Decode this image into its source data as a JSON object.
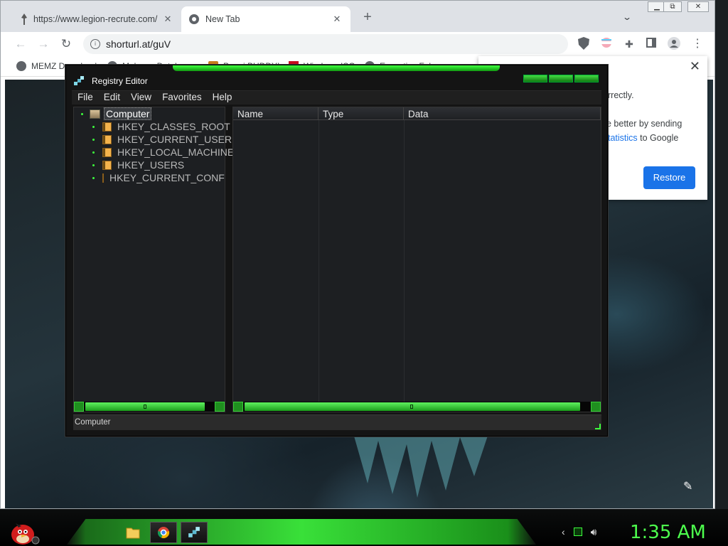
{
  "browser": {
    "tabs": [
      {
        "title": "https://www.legion-recrute.com/",
        "close": "✕"
      },
      {
        "title": "New Tab",
        "close": "✕"
      }
    ],
    "new_tab": "+",
    "url": "shorturl.at/guV",
    "bookmarks": [
      "MEMZ Download",
      "Malware Databases",
      "Penni BUDDY!",
      "Windows ISOs",
      "Executive Ful..."
    ],
    "popup": {
      "line1": "rrectly.",
      "line2": "e better by sending",
      "line3_link": "tatistics",
      "line3_rest": " to Google",
      "restore_label": "Restore",
      "close": "✕"
    }
  },
  "regedit": {
    "title": "Registry Editor",
    "menu": [
      "File",
      "Edit",
      "View",
      "Favorites",
      "Help"
    ],
    "tree": {
      "root": "Computer",
      "keys": [
        "HKEY_CLASSES_ROOT",
        "HKEY_CURRENT_USER",
        "HKEY_LOCAL_MACHINE",
        "HKEY_USERS",
        "HKEY_CURRENT_CONFIG"
      ]
    },
    "columns": [
      "Name",
      "Type",
      "Data"
    ],
    "status": "Computer"
  },
  "taskbar": {
    "clock": "1:35 AM"
  },
  "colors": {
    "accent_green": "#3dff3d",
    "chrome_blue": "#1a73e8"
  }
}
